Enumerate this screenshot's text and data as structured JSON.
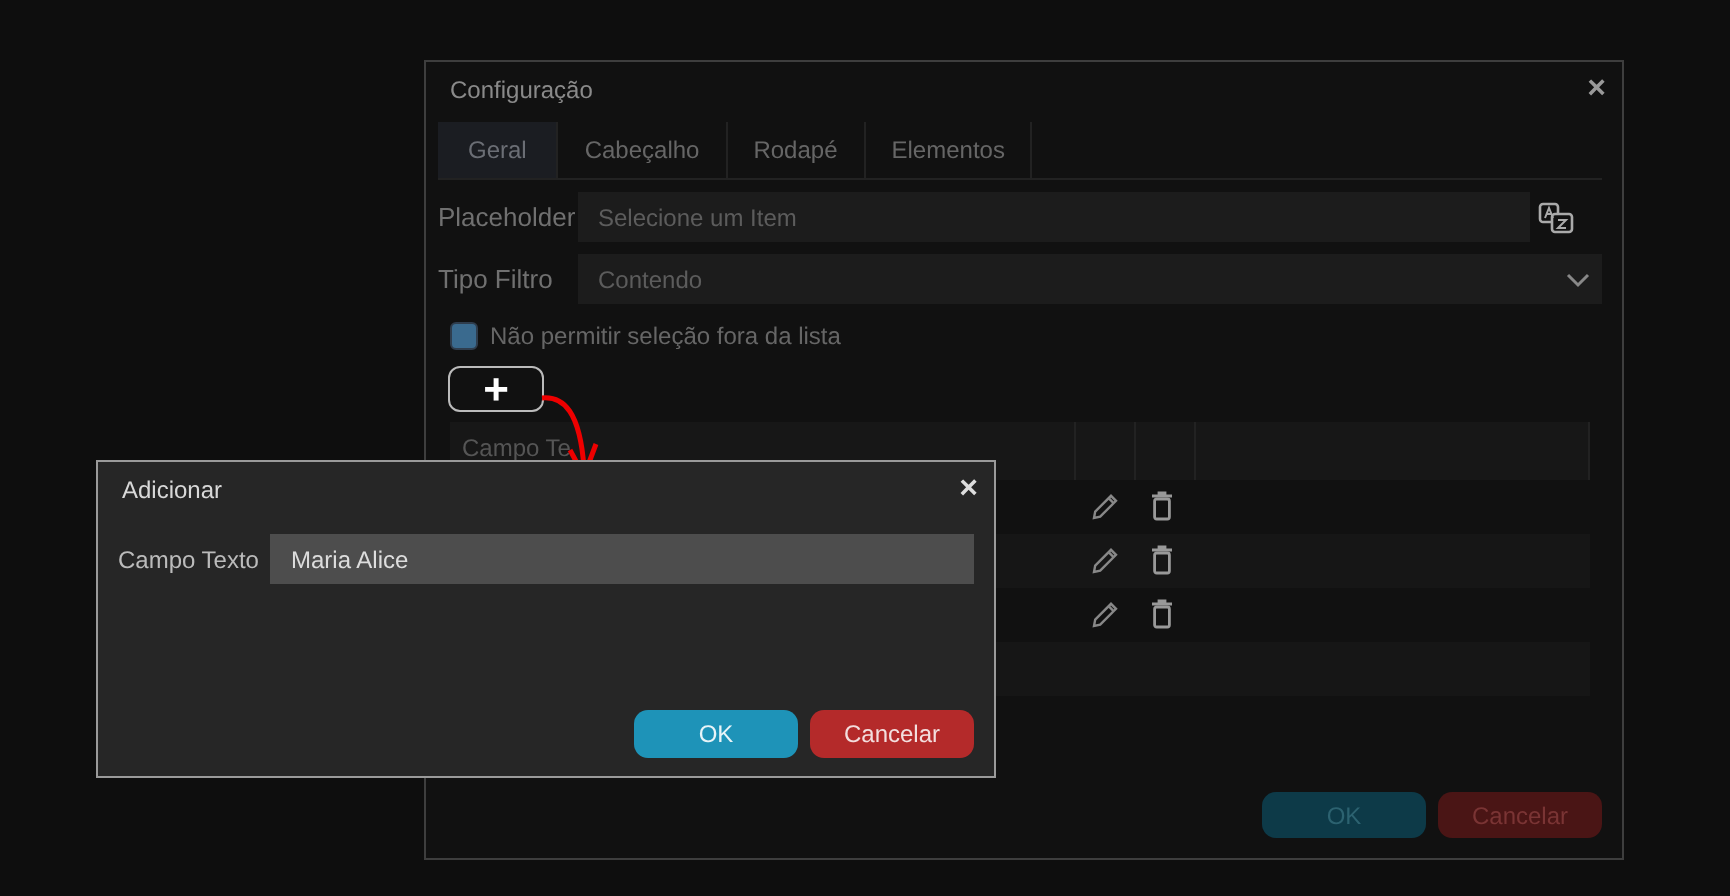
{
  "window": {
    "title": "Configuração",
    "close": "×"
  },
  "tabs": [
    {
      "label": "Geral",
      "selected": true
    },
    {
      "label": "Cabeçalho",
      "selected": false
    },
    {
      "label": "Rodapé",
      "selected": false
    },
    {
      "label": "Elementos",
      "selected": false
    }
  ],
  "placeholder_field": {
    "label": "Placeholder",
    "placeholder": "Selecione um Item"
  },
  "filter_field": {
    "label": "Tipo Filtro",
    "value": "Contendo"
  },
  "restrict_checkbox": {
    "label": "Não permitir seleção fora da lista",
    "checked": true
  },
  "add_button": {
    "icon": "+"
  },
  "table": {
    "columns": [
      "Campo Te"
    ],
    "rows": [
      {
        "actions": true
      },
      {
        "actions": true
      },
      {
        "actions": true
      },
      {
        "actions": false
      }
    ]
  },
  "buttons": [
    {
      "label": "OK",
      "kind": "ok"
    },
    {
      "label": "Cancelar",
      "kind": "cancel"
    }
  ],
  "dialog": {
    "title": "Adicionar",
    "close": "×",
    "field": {
      "label": "Campo Texto",
      "value": "Maria Alice"
    },
    "buttons": [
      {
        "label": "OK",
        "kind": "ok"
      },
      {
        "label": "Cancelar",
        "kind": "cancel"
      }
    ]
  }
}
